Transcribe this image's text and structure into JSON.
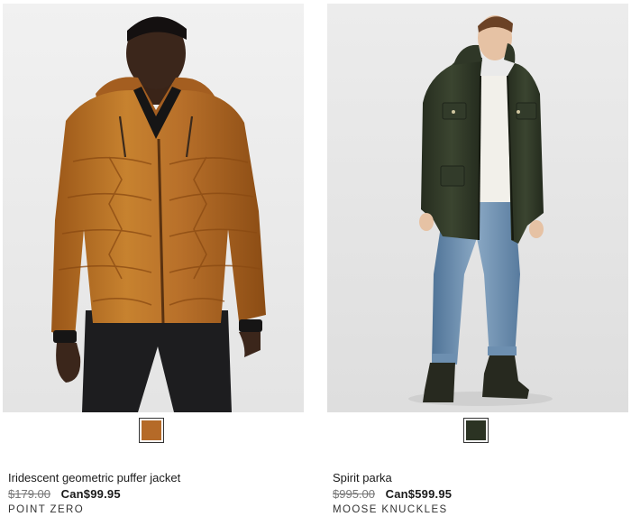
{
  "products": [
    {
      "name": "Iridescent geometric puffer jacket",
      "original_price": "$179.00",
      "sale_price": "Can$99.95",
      "brand": "POINT ZERO",
      "image_label": "man-wearing-orange-puffer-jacket",
      "swatch_color": "#b56a28"
    },
    {
      "name": "Spirit parka",
      "original_price": "$995.00",
      "sale_price": "Can$599.95",
      "brand": "MOOSE KNUCKLES",
      "image_label": "man-wearing-green-parka-and-jeans",
      "swatch_color": "#2b3323"
    }
  ]
}
